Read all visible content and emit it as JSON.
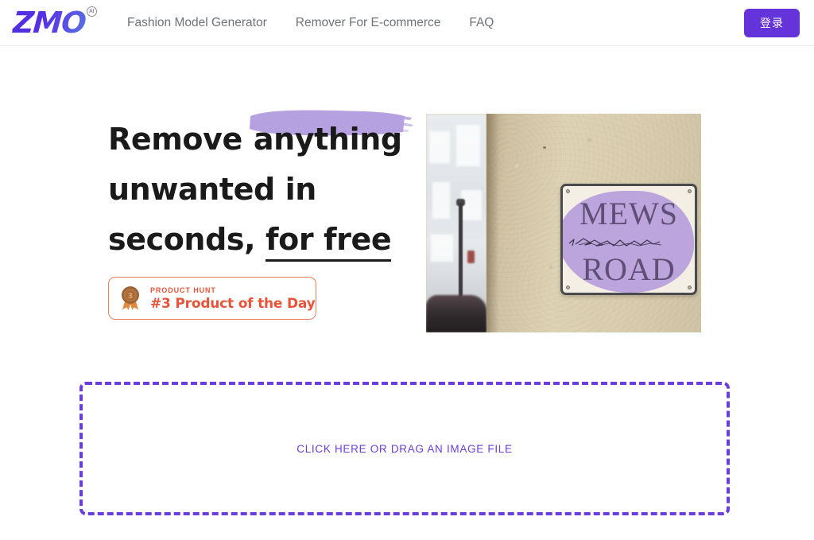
{
  "header": {
    "logo": {
      "text": "ZMO",
      "badge": "AI",
      "icon": "zmo-logo"
    },
    "nav": [
      {
        "label": "Fashion Model Generator"
      },
      {
        "label": "Remover For E-commerce"
      },
      {
        "label": "FAQ"
      }
    ],
    "login_label": "登录"
  },
  "hero": {
    "headline": {
      "line1_plain": "Remove",
      "line1_highlight": "anything",
      "line2": "unwanted in",
      "line3_plain": "seconds,",
      "line3_underline": "for free"
    },
    "product_hunt": {
      "medal_rank": "3",
      "kicker": "PRODUCT HUNT",
      "title": "#3 Product of the Day"
    },
    "image": {
      "sign_line1": "MEWS",
      "sign_line2": "ROAD"
    }
  },
  "dropzone": {
    "label": "CLICK HERE OR DRAG AN IMAGE FILE"
  },
  "colors": {
    "brand_purple": "#6433da",
    "dropzone_purple": "#6b3ddb",
    "highlight_purple": "#b5a0e0",
    "product_hunt_orange": "#e8543a",
    "product_hunt_border": "#e8805e",
    "nav_gray": "#6f7378",
    "headline_black": "#1a1a1a"
  }
}
